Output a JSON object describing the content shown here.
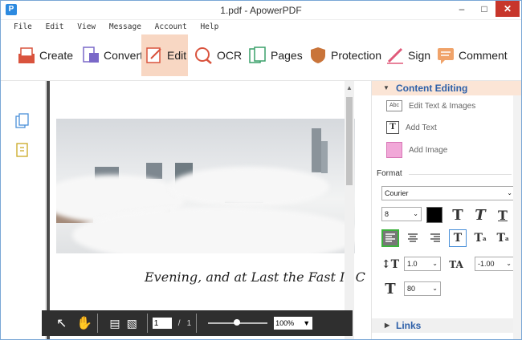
{
  "window": {
    "title": "1.pdf - ApowerPDF",
    "app_icon": "P"
  },
  "menu": [
    "File",
    "Edit",
    "View",
    "Message",
    "Account",
    "Help"
  ],
  "toolbar": {
    "create": "Create",
    "convert": "Convert",
    "edit": "Edit",
    "ocr": "OCR",
    "pages": "Pages",
    "protection": "Protection",
    "sign": "Sign",
    "comment": "Comment"
  },
  "document": {
    "text_line": "Evening, and at Last the Fast Is C"
  },
  "viewer": {
    "current_page": "1",
    "separator": "/",
    "total_pages": "1",
    "zoom": "100%"
  },
  "panel": {
    "content_editing": "Content Editing",
    "edit_text_images": "Edit Text & Images",
    "add_text": "Add Text",
    "add_image": "Add Image",
    "format_label": "Format",
    "font": "Courier",
    "font_size": "8",
    "line_spacing": "1.0",
    "char_spacing": "-1.00",
    "scale": "80",
    "links": "Links"
  },
  "colors": {
    "accent": "#f8d7c3",
    "close": "#c7362b",
    "heading": "#2c5fa8"
  }
}
